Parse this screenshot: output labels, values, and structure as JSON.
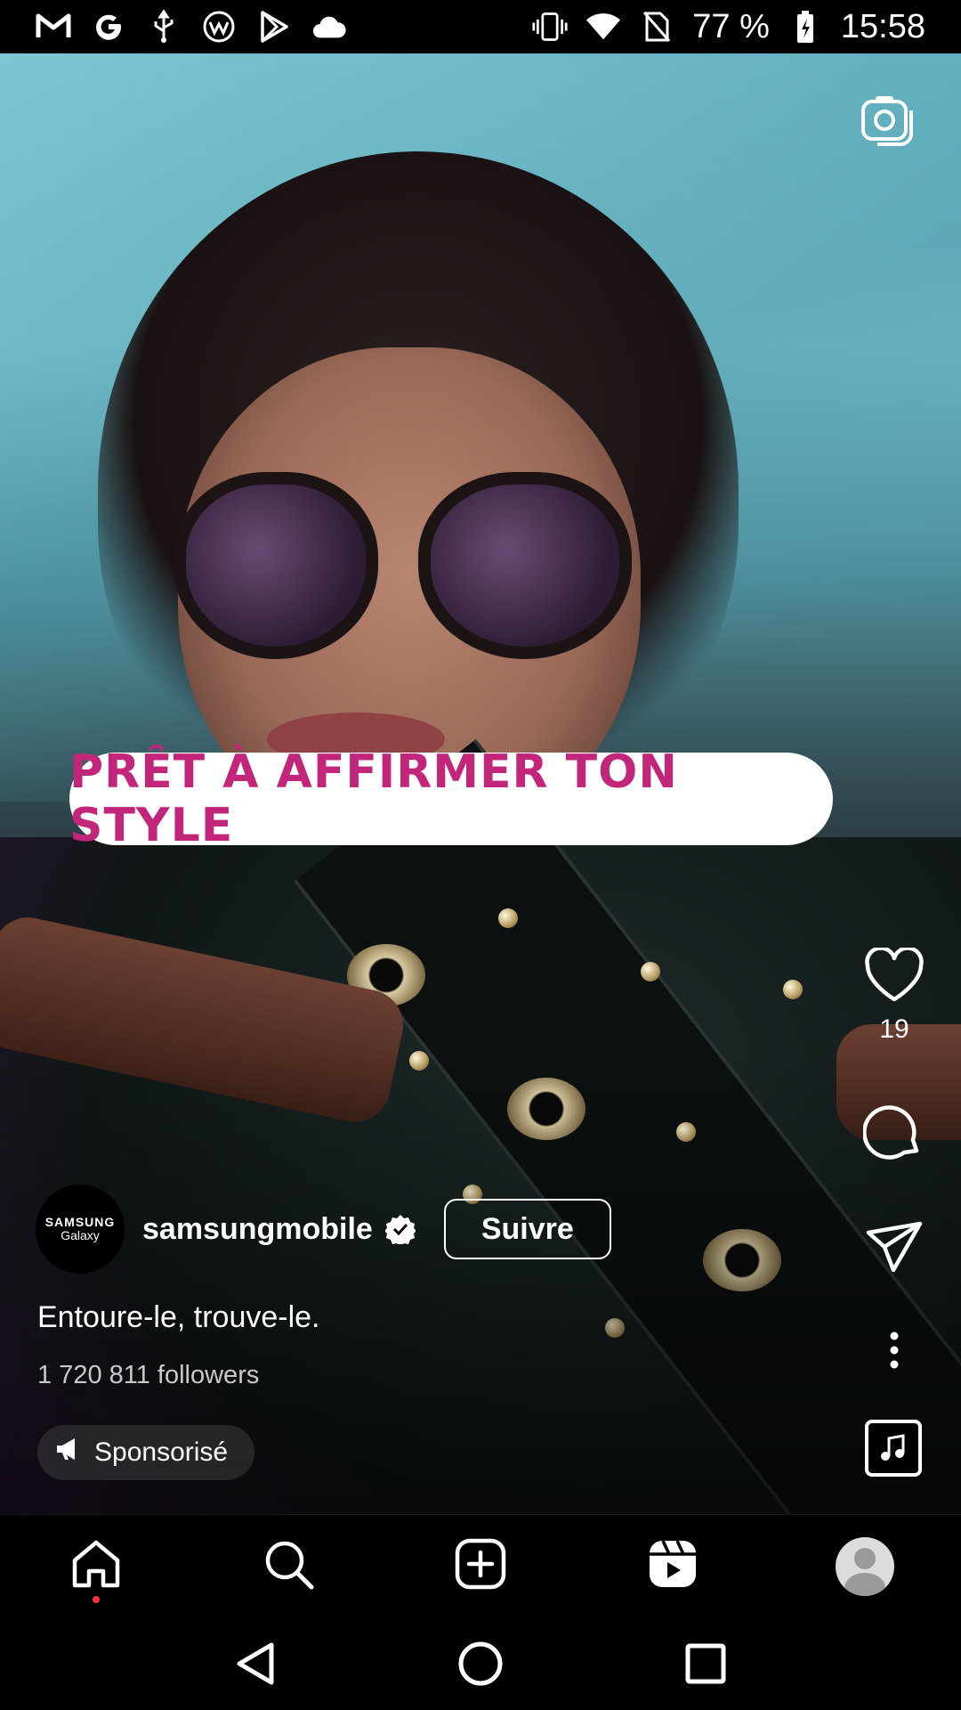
{
  "status_bar": {
    "left_icons": [
      "gmail-icon",
      "google-icon",
      "usb-icon",
      "vpn-icon",
      "play-store-icon",
      "cloud-icon"
    ],
    "right_icons": [
      "vibrate-icon",
      "wifi-icon",
      "no-sim-icon",
      "battery-charging-icon"
    ],
    "battery": "77 %",
    "time": "15:58"
  },
  "reel": {
    "banner_text": "PRÊT À AFFIRMER TON STYLE",
    "camera_icon": "camera-icon",
    "like_count": "19",
    "right_rail_icons": [
      "heart-icon",
      "comment-icon",
      "share-icon",
      "more-icon",
      "audio-icon"
    ],
    "author": {
      "avatar_line1": "SAMSUNG",
      "avatar_line2": "Galaxy",
      "username": "samsungmobile",
      "verified_icon": "verified-icon",
      "follow_label": "Suivre"
    },
    "caption": "Entoure-le, trouve-le.",
    "followers": "1 720 811 followers",
    "sponsored_label": "Sponsorisé",
    "banner_color": "#c1267a"
  },
  "tab_bar": {
    "items": [
      "home-icon",
      "search-icon",
      "create-icon",
      "reels-icon",
      "profile-icon"
    ],
    "notification_dot_color": "#ff3040"
  },
  "android_nav": [
    "back-icon",
    "home-circle-icon",
    "recents-icon"
  ]
}
